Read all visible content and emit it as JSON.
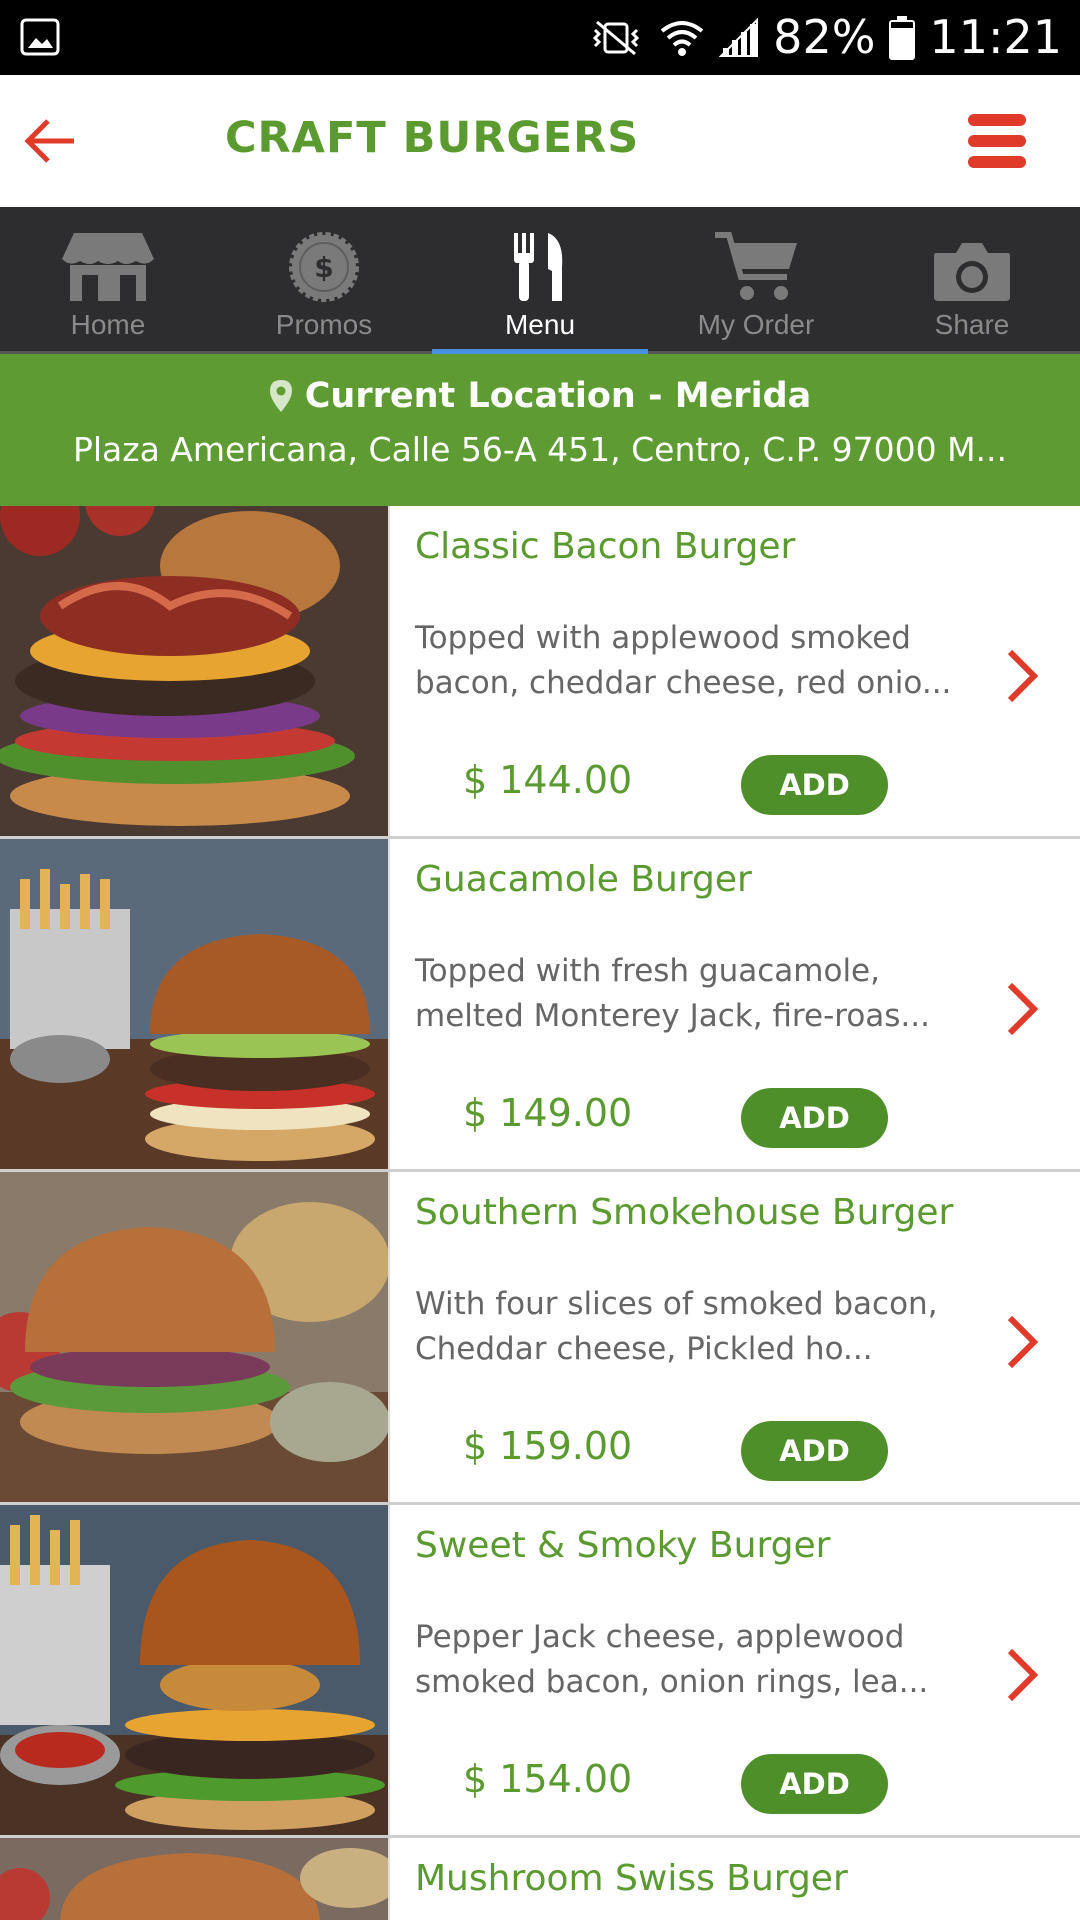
{
  "status_bar": {
    "battery": "82%",
    "time": "11:21",
    "icons": [
      "gallery-icon",
      "vibrate-mute-icon",
      "wifi-icon",
      "signal-icon",
      "battery-icon"
    ]
  },
  "app_bar": {
    "title": "CRAFT BURGERS",
    "back_icon": "arrow-left-icon",
    "menu_icon": "hamburger-menu-icon"
  },
  "tabs": [
    {
      "label": "Home",
      "icon": "store-icon",
      "active": false
    },
    {
      "label": "Promos",
      "icon": "promo-badge-icon",
      "active": false
    },
    {
      "label": "Menu",
      "icon": "fork-knife-icon",
      "active": true
    },
    {
      "label": "My Order",
      "icon": "cart-icon",
      "active": false
    },
    {
      "label": "Share",
      "icon": "camera-icon",
      "active": false
    }
  ],
  "location": {
    "title": "Current Location - Merida",
    "address": "Plaza Americana, Calle 56-A 451, Centro, C.P. 97000 M..."
  },
  "menu_items": [
    {
      "name": "Classic Bacon Burger",
      "description": "Topped with applewood smoked bacon, cheddar cheese, red onio...",
      "price": "$ 144.00",
      "add_label": "ADD"
    },
    {
      "name": "Guacamole Burger",
      "description": "Topped with fresh guacamole, melted Monterey Jack, fire-roas...",
      "price": "$ 149.00",
      "add_label": "ADD"
    },
    {
      "name": "Southern Smokehouse Burger",
      "description": "With four slices of smoked bacon, Cheddar cheese, Pickled ho...",
      "price": "$ 159.00",
      "add_label": "ADD"
    },
    {
      "name": "Sweet & Smoky Burger",
      "description": "Pepper Jack cheese, applewood smoked bacon, onion rings, lea...",
      "price": "$ 154.00",
      "add_label": "ADD"
    },
    {
      "name": "Mushroom Swiss Burger"
    }
  ],
  "colors": {
    "brand_green": "#5a9a2f",
    "accent_red": "#e03a2a",
    "tab_bar_bg": "#2d2d2f",
    "active_indicator": "#4a90e2"
  }
}
